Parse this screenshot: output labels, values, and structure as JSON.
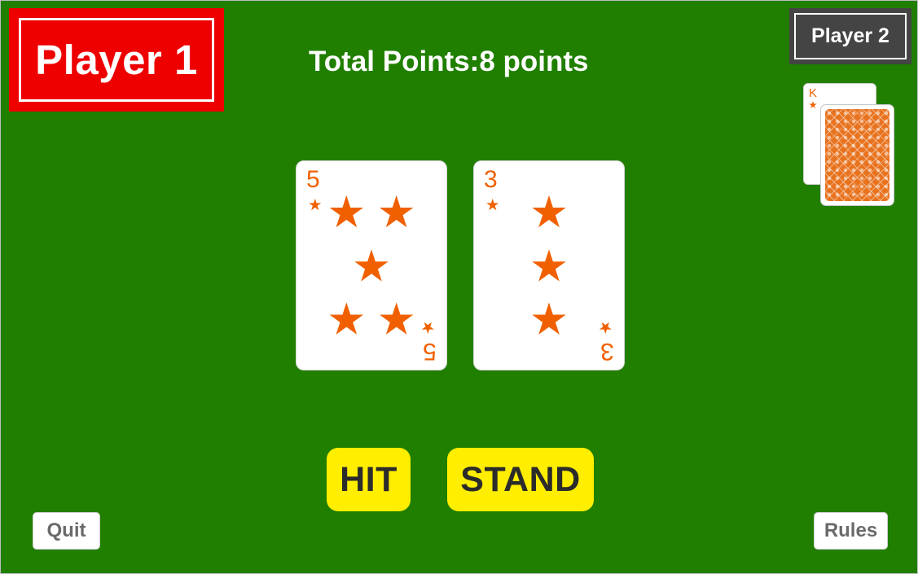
{
  "players": {
    "player1_label": "Player 1",
    "player2_label": "Player 2"
  },
  "score": {
    "label": "Total Points:",
    "value": "8 points"
  },
  "hand": [
    {
      "rank": "5",
      "suit": "star-icon",
      "pips": 5
    },
    {
      "rank": "3",
      "suit": "star-icon",
      "pips": 3
    }
  ],
  "opponent": {
    "visible_card_rank": "K",
    "visible_card_suit": "star-icon",
    "hidden_card": "card-back"
  },
  "actions": {
    "hit_label": "HIT",
    "stand_label": "STAND",
    "quit_label": "Quit",
    "rules_label": "Rules"
  },
  "colors": {
    "table": "#217f00",
    "player1": "#ee0000",
    "player2": "#444444",
    "suit": "#f06000",
    "button": "#ffee00"
  }
}
